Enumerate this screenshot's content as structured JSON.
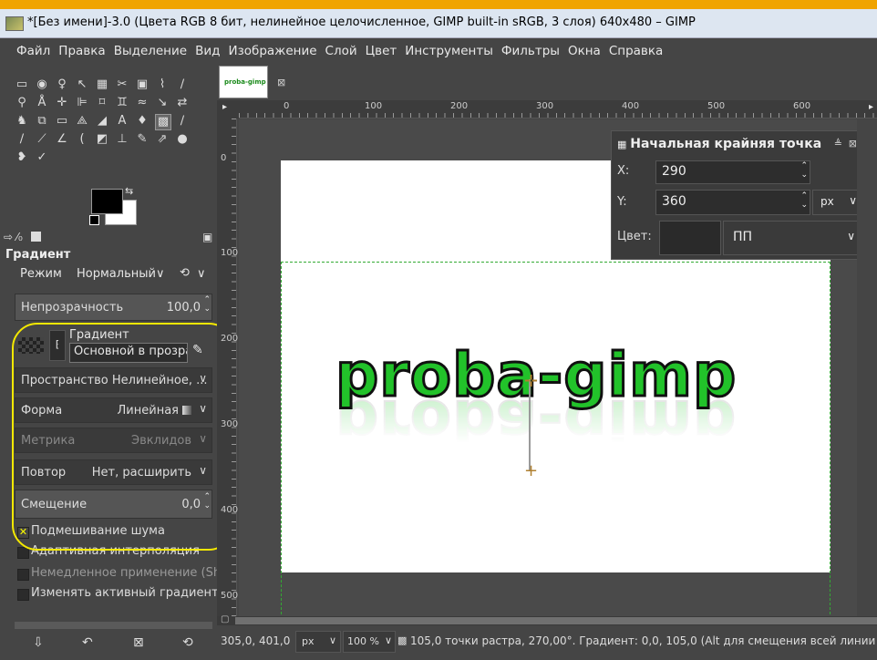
{
  "window": {
    "title": "*[Без имени]-3.0 (Цвета RGB 8 бит, нелинейное целочисленное, GIMP built-in sRGB, 3 слоя) 640x480 – GIMP"
  },
  "menu": [
    "Файл",
    "Правка",
    "Выделение",
    "Вид",
    "Изображение",
    "Слой",
    "Цвет",
    "Инструменты",
    "Фильтры",
    "Окна",
    "Справка"
  ],
  "image_tab": {
    "thumb_text": "proba-gimp",
    "close": "⊠"
  },
  "tool_options": {
    "title": "Градиент",
    "mode_label": "Режим",
    "mode_value": "Нормальный",
    "opacity_label": "Непрозрачность",
    "opacity_value": "100,0",
    "gradient_label": "Градиент",
    "gradient_value": "Основной в прозрач",
    "space_label": "Пространство Нелинейное, ...",
    "shape_label": "Форма",
    "shape_value": "Линейная",
    "metric_label": "Метрика",
    "metric_value": "Эвклидов",
    "repeat_label": "Повтор",
    "repeat_value": "Нет, расширить",
    "offset_label": "Смещение",
    "offset_value": "0,0",
    "dither_label": "Подмешивание шума",
    "dither_checked": true,
    "adaptive_label": "Адаптивная интерполяция",
    "instant_label": "Немедленное применение (Shift)",
    "modify_label": "Изменять активный градиент"
  },
  "ruler": {
    "h_labels": [
      "0",
      "100",
      "200",
      "300",
      "400",
      "500",
      "600"
    ],
    "v_labels": [
      "0",
      "100",
      "200",
      "300",
      "400",
      "500"
    ]
  },
  "canvas": {
    "text": "proba-gimp",
    "text_color": "#22c22a"
  },
  "endpoint_dialog": {
    "title": "Начальная крайняя точка",
    "x_label": "X:",
    "x_value": "290",
    "y_label": "Y:",
    "y_value": "360",
    "unit": "px",
    "color_label": "Цвет:",
    "color_mode": "ПП"
  },
  "status": {
    "coords": "305,0, 401,0",
    "unit": "px",
    "zoom": "100 %",
    "message": "105,0 точки растра, 270,00°. Градиент: 0,0, 105,0 (Alt для смещения всей линии"
  }
}
